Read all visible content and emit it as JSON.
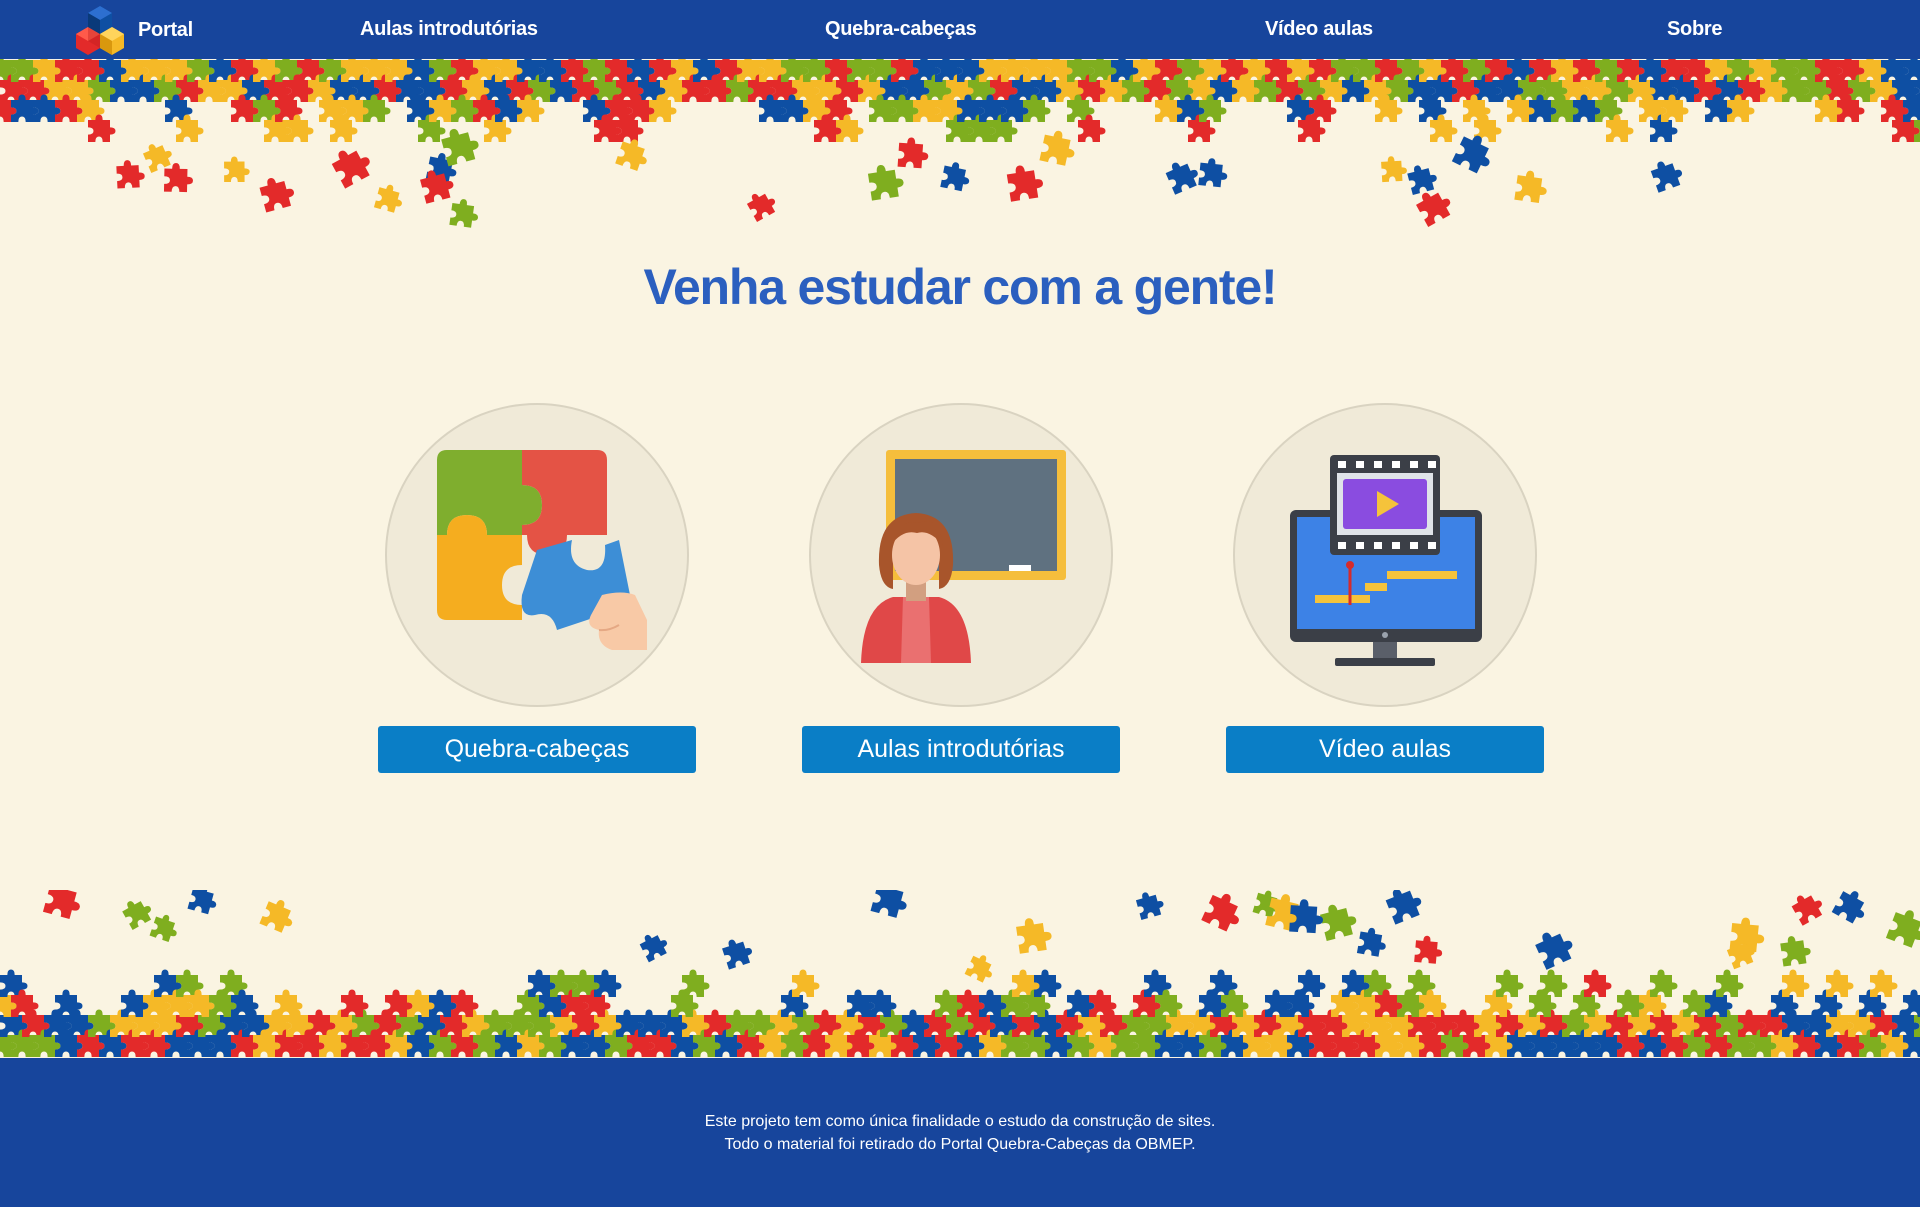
{
  "nav": {
    "brand_label": "Portal",
    "links": [
      {
        "label": "Aulas introdutórias"
      },
      {
        "label": "Quebra-cabeças"
      },
      {
        "label": "Vídeo aulas"
      },
      {
        "label": "Sobre"
      }
    ]
  },
  "hero": {
    "headline": "Venha estudar com a gente!"
  },
  "cards": [
    {
      "button_label": "Quebra-cabeças",
      "icon": "puzzle-hand-icon"
    },
    {
      "button_label": "Aulas introdutórias",
      "icon": "teacher-blackboard-icon"
    },
    {
      "button_label": "Vídeo aulas",
      "icon": "video-monitor-icon"
    }
  ],
  "footer": {
    "line1": "Este projeto tem como única finalidade o estudo da construção de sites.",
    "line2": "Todo o material foi retirado do Portal Quebra-Cabeças da OBMEP."
  },
  "colors": {
    "nav_bg": "#17459c",
    "page_bg": "#faf4e2",
    "headline": "#2b5fbf",
    "button": "#0a7ec6",
    "puzzle": [
      "#e32a2a",
      "#f5b927",
      "#7fae1f",
      "#0e4fa3"
    ]
  }
}
